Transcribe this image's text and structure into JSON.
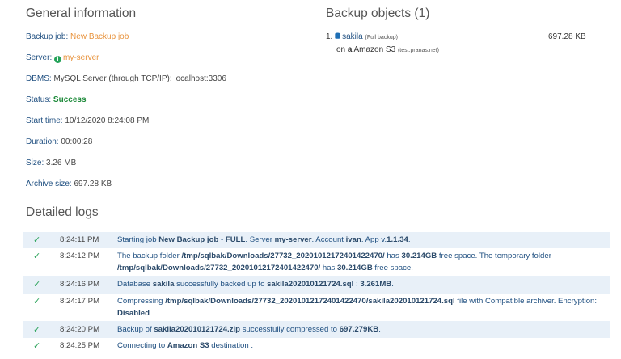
{
  "general": {
    "title": "General information",
    "backup_job_label": "Backup job:",
    "backup_job_value": "New Backup job",
    "server_label": "Server:",
    "server_value": "my-server",
    "dbms_label": "DBMS:",
    "dbms_value": "MySQL Server (through TCP/IP): localhost:3306",
    "status_label": "Status:",
    "status_value": "Success",
    "start_label": "Start time:",
    "start_value": "10/12/2020 8:24:08 PM",
    "duration_label": "Duration:",
    "duration_value": "00:00:28",
    "size_label": "Size:",
    "size_value": "3.26 MB",
    "archive_label": "Archive size:",
    "archive_value": "697.28 KB"
  },
  "objects": {
    "title": "Backup objects (1)",
    "index": "1.",
    "db_name": "sakila",
    "db_note": "(Full backup)",
    "size": "697.28 KB",
    "on_label": "on",
    "destination": "Amazon S3",
    "destination_note": "(test.pranas.net)"
  },
  "logs": {
    "title": "Detailed logs",
    "entries": [
      {
        "time": "8:24:11 PM",
        "parts": [
          [
            "Starting job ",
            false
          ],
          [
            "New Backup job",
            true
          ],
          [
            " - ",
            false
          ],
          [
            "FULL",
            true
          ],
          [
            ". Server ",
            false
          ],
          [
            "my-server",
            true
          ],
          [
            ". Account ",
            false
          ],
          [
            "ivan",
            true
          ],
          [
            ". App v.",
            false
          ],
          [
            "1.1.34",
            true
          ],
          [
            ".",
            false
          ]
        ]
      },
      {
        "time": "8:24:12 PM",
        "parts": [
          [
            "The backup folder ",
            false
          ],
          [
            "/tmp/sqlbak/Downloads/27732_20201012172401422470/",
            true
          ],
          [
            " has ",
            false
          ],
          [
            "30.214GB",
            true
          ],
          [
            " free space. The temporary folder ",
            false
          ],
          [
            "/tmp/sqlbak/Downloads/27732_20201012172401422470/",
            true
          ],
          [
            " has ",
            false
          ],
          [
            "30.214GB",
            true
          ],
          [
            " free space.",
            false
          ]
        ]
      },
      {
        "time": "8:24:16 PM",
        "parts": [
          [
            "Database ",
            false
          ],
          [
            "sakila",
            true
          ],
          [
            " successfully backed up to ",
            false
          ],
          [
            "sakila202010121724.sql",
            true
          ],
          [
            " : ",
            false
          ],
          [
            "3.261MB",
            true
          ],
          [
            ".",
            false
          ]
        ]
      },
      {
        "time": "8:24:17 PM",
        "parts": [
          [
            "Compressing ",
            false
          ],
          [
            "/tmp/sqlbak/Downloads/27732_20201012172401422470/sakila202010121724.sql",
            true
          ],
          [
            " file with Compatible archiver. Encryption: ",
            false
          ],
          [
            "Disabled",
            true
          ],
          [
            ".",
            false
          ]
        ]
      },
      {
        "time": "8:24:20 PM",
        "parts": [
          [
            "Backup of ",
            false
          ],
          [
            "sakila202010121724.zip",
            true
          ],
          [
            " successfully compressed to ",
            false
          ],
          [
            "697.279KB",
            true
          ],
          [
            ".",
            false
          ]
        ]
      },
      {
        "time": "8:24:25 PM",
        "parts": [
          [
            "Connecting to ",
            false
          ],
          [
            "Amazon S3",
            true
          ],
          [
            " destination  .",
            false
          ]
        ]
      }
    ]
  },
  "icons": {
    "check": "check-icon",
    "server": "server-status-icon",
    "database": "database-icon",
    "amazon": "amazon-icon"
  },
  "colors": {
    "link": "#e8923b",
    "success": "#1d8a3a",
    "label": "#1f4f80",
    "row_alt": "#e8f0f8"
  }
}
